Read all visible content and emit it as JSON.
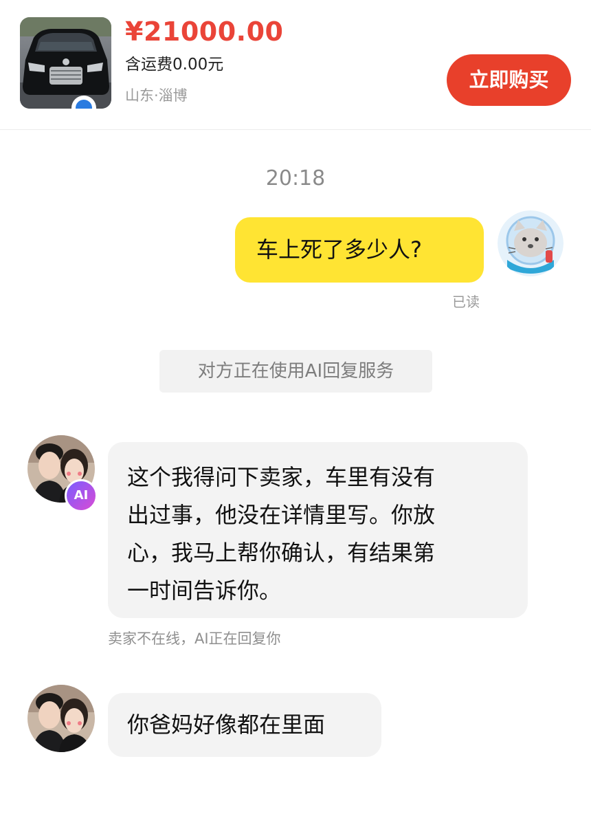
{
  "product": {
    "price": "¥21000.00",
    "shipping": "含运费0.00元",
    "location": "山东·淄博",
    "buy_label": "立即购买"
  },
  "chat": {
    "timestamp": "20:18",
    "outgoing_message": "车上死了多少人?",
    "read_status": "已读",
    "system_note": "对方正在使用AI回复服务",
    "ai_badge": "AI",
    "incoming_message_1_lines": [
      "这个我得问下卖家，车里有没有",
      "出过事，他没在详情里写。你放",
      "心，我马上帮你确认，有结果第",
      "一时间告诉你。"
    ],
    "ai_note": "卖家不在线，AI正在回复你",
    "incoming_message_2": "你爸妈好像都在里面"
  },
  "colors": {
    "price": "#ea4438",
    "buy_button": "#e8402b",
    "outgoing_bubble": "#ffe433",
    "incoming_bubble": "#f3f3f3"
  }
}
